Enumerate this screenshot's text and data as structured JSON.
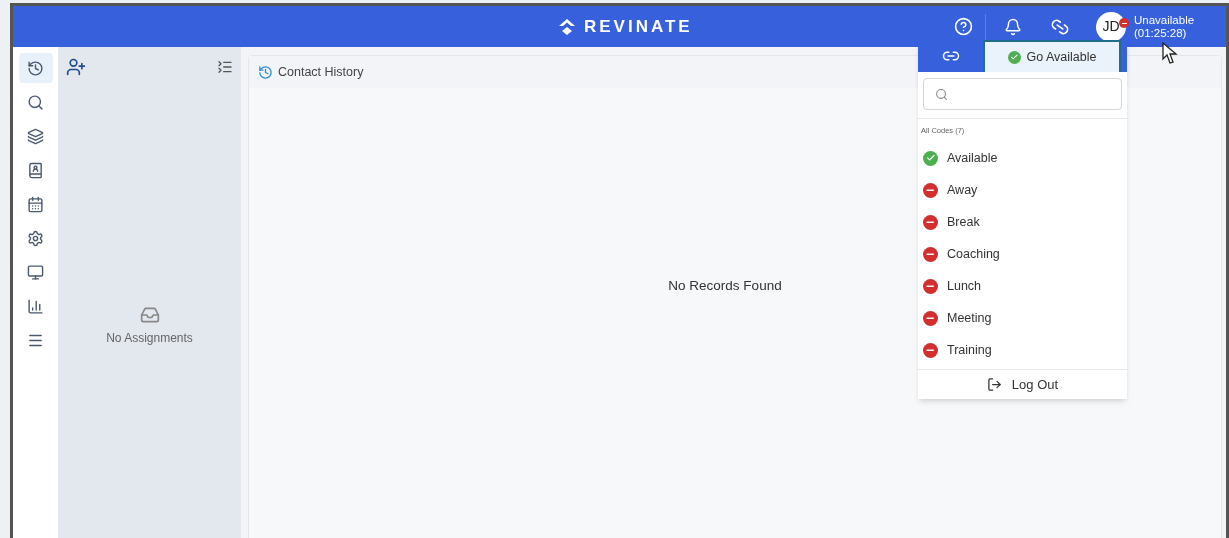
{
  "header": {
    "logo": "REVINATE",
    "user": {
      "initials": "JD",
      "available": false,
      "status": "Unavailable",
      "timer": "(01:25:28)"
    }
  },
  "sidebar": {
    "items": [
      {
        "selected": true
      },
      {
        "selected": false
      },
      {
        "selected": false
      },
      {
        "selected": false
      },
      {
        "selected": false
      },
      {
        "selected": false
      },
      {
        "selected": false
      },
      {
        "selected": false
      },
      {
        "selected": false
      }
    ]
  },
  "assignments": {
    "empty_text": "No Assignments"
  },
  "main": {
    "title": "Contact History",
    "empty_text": "No Records Found"
  },
  "status_menu": {
    "button": "Go Available",
    "section": "All Codes (7)",
    "codes": [
      {
        "label": "Available",
        "kind": "available"
      },
      {
        "label": "Away",
        "kind": "unavailable"
      },
      {
        "label": "Break",
        "kind": "unavailable"
      },
      {
        "label": "Coaching",
        "kind": "unavailable"
      },
      {
        "label": "Lunch",
        "kind": "unavailable"
      },
      {
        "label": "Meeting",
        "kind": "unavailable"
      },
      {
        "label": "Training",
        "kind": "unavailable"
      }
    ],
    "logout": "Log Out"
  }
}
